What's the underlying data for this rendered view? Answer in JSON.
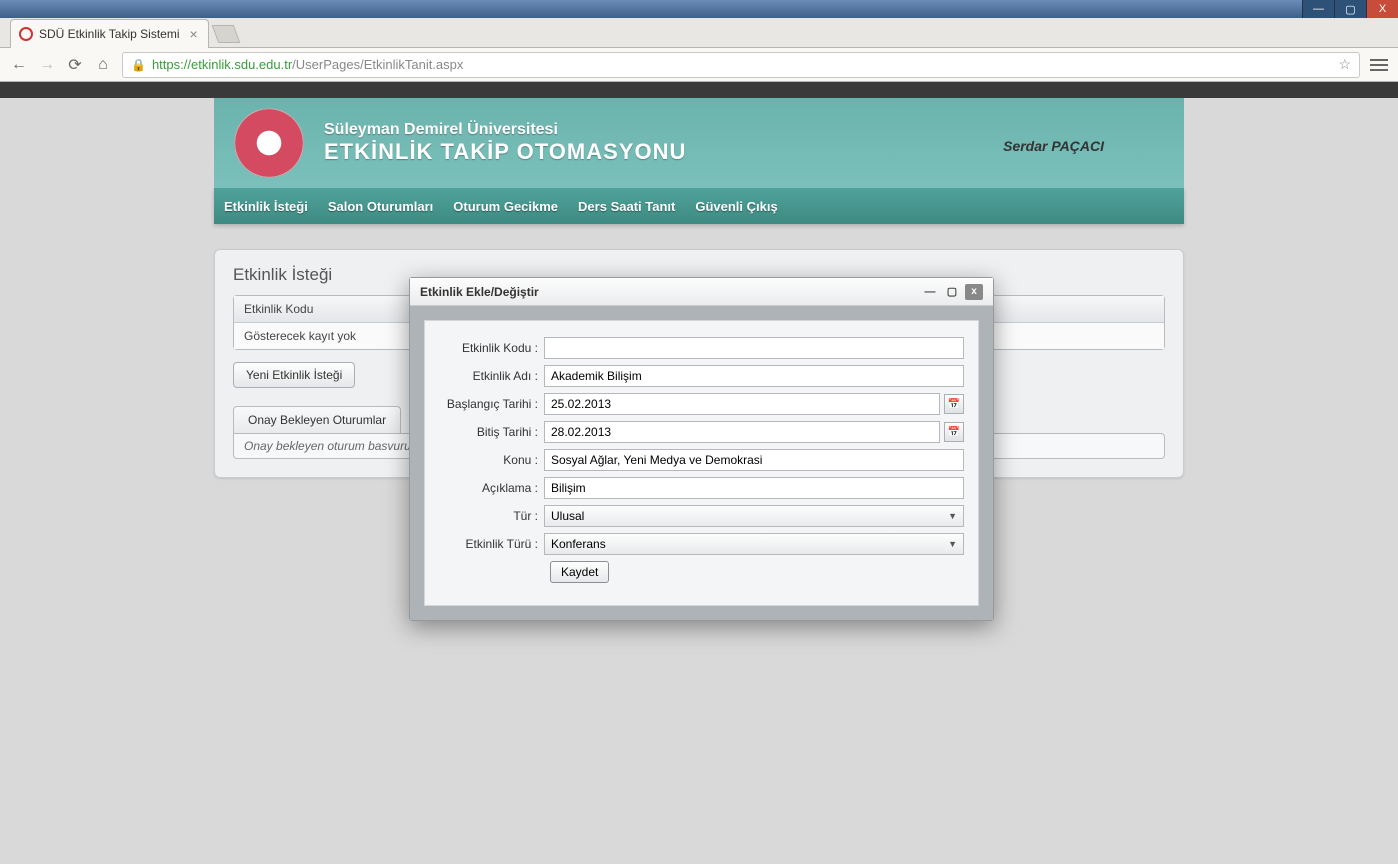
{
  "window": {
    "min": "—",
    "max": "▢",
    "close": "X"
  },
  "browser": {
    "tab_title": "SDÜ Etkinlik Takip Sistemi",
    "url_scheme": "https://",
    "url_host": "etkinlik.sdu.edu.tr",
    "url_path": "/UserPages/EtkinlikTanit.aspx"
  },
  "header": {
    "university": "Süleyman Demirel Üniversitesi",
    "app_name": "ETKİNLİK TAKİP OTOMASYONU",
    "username": "Serdar PAÇACI"
  },
  "nav": {
    "items": [
      "Etkinlik İsteği",
      "Salon Oturumları",
      "Oturum Gecikme",
      "Ders Saati Tanıt",
      "Güvenli Çıkış"
    ]
  },
  "panel": {
    "title": "Etkinlik İsteği",
    "grid_header": "Etkinlik Kodu",
    "grid_empty": "Gösterecek kayıt yok",
    "new_button": "Yeni Etkinlik İsteği",
    "tab_label": "Onay Bekleyen Oturumlar",
    "tab_msg": "Onay bekleyen oturum basvurunu"
  },
  "modal": {
    "title": "Etkinlik Ekle/Değiştir",
    "fields": {
      "kodu_label": "Etkinlik Kodu :",
      "kodu_value": "",
      "adi_label": "Etkinlik Adı :",
      "adi_value": "Akademik Bilişim",
      "baslangic_label": "Başlangıç Tarihi :",
      "baslangic_value": "25.02.2013",
      "bitis_label": "Bitiş Tarihi :",
      "bitis_value": "28.02.2013",
      "konu_label": "Konu :",
      "konu_value": "Sosyal Ağlar, Yeni Medya ve Demokrasi",
      "aciklama_label": "Açıklama :",
      "aciklama_value": "Bilişim",
      "tur_label": "Tür :",
      "tur_value": "Ulusal",
      "etkinlik_turu_label": "Etkinlik Türü :",
      "etkinlik_turu_value": "Konferans",
      "submit": "Kaydet"
    }
  }
}
